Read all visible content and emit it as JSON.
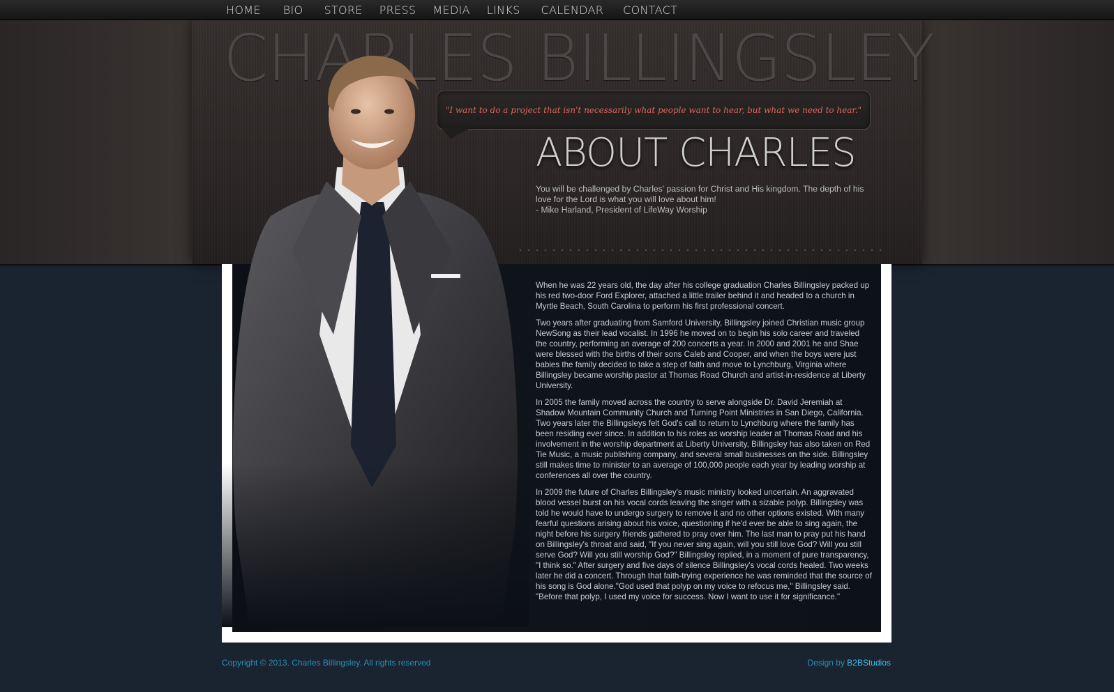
{
  "nav": {
    "items": [
      {
        "label": "HOME"
      },
      {
        "label": "BIO"
      },
      {
        "label": "STORE"
      },
      {
        "label": "PRESS"
      },
      {
        "label": "MEDIA"
      },
      {
        "label": "LINKS"
      },
      {
        "label": "CALENDAR"
      },
      {
        "label": "CONTACT"
      }
    ]
  },
  "header": {
    "artist_name": "CHARLES BILLINGSLEY",
    "quote": "\"I want to do a project that isn't necessarily what people want to hear, but what we need to hear.\"",
    "section_title": "ABOUT CHARLES",
    "endorsement": {
      "text": "You will be challenged by Charles' passion for Christ and His kingdom. The depth of his love for the Lord is what you will love about him!",
      "attribution": "- Mike Harland, President of LifeWay Worship"
    }
  },
  "bio": {
    "paragraphs": [
      "When he was 22 years old, the day after his college graduation Charles Billingsley packed up his red two-door Ford Explorer, attached a little trailer behind it and headed to a church in Myrtle Beach, South Carolina to perform his first professional concert.",
      "Two years after graduating from Samford University, Billingsley joined Christian music group NewSong as their lead vocalist. In 1996 he moved on to begin his solo career and traveled the country, performing an average of 200 concerts a year. In 2000 and 2001 he and Shae were blessed with the births of their sons Caleb and Cooper, and when the boys were just babies the family decided to take a step of faith and move to Lynchburg, Virginia where Billingsley became worship pastor at Thomas Road Church and artist-in-residence at Liberty University.",
      "In 2005 the family moved across the country to serve alongside Dr. David Jeremiah at Shadow Mountain Community Church and Turning Point Ministries in San Diego, California. Two years later the Billingsleys felt God's call to return to Lynchburg where the family has been residing ever since. In addition to his roles as worship leader at Thomas Road and his involvement in the worship department at Liberty University, Billingsley has also taken on Red Tie Music, a music publishing company, and several small businesses on the side. Billingsley still makes time to minister to an average of 100,000 people each year by leading worship at conferences all over the country.",
      "In 2009 the future of Charles Billingsley's music ministry looked uncertain. An aggravated blood vessel burst on his vocal cords leaving the singer with a sizable polyp. Billingsley was told he would have to undergo surgery to remove it and no other options existed. With many fearful questions arising about his voice, questioning if he'd ever be able to sing again, the night before his surgery friends gathered to pray over him. The last man to pray put his hand on Billingsley's throat and said, \"If you never sing again, will you still love God? Will you still serve God? Will you still worship God?\" Billingsley replied, in a moment of pure transparency, \"I think so.\" After surgery and five days of silence Billingsley's vocal cords healed. Two weeks later he did a concert. Through that faith-trying experience he was reminded that the source of his song is God alone.\"God used that polyp on my voice to refocus me,\" Billingsley said. \"Before that polyp, I used my voice for success. Now I want to use it for significance.\""
    ]
  },
  "footer": {
    "copyright": "Copyright © 2013. Charles Billingsley. All rights reserved",
    "design_prefix": "Design by ",
    "design_studio": "B2BStudios"
  },
  "colors": {
    "quote": "#d9675a",
    "footer_link": "#2a8fb3",
    "page_bg": "#1a2330"
  }
}
